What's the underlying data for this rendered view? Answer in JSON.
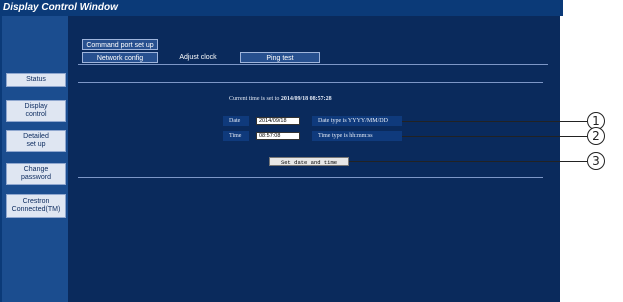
{
  "window": {
    "title": "Display Control Window"
  },
  "sidebar": {
    "items": [
      {
        "label": "Status"
      },
      {
        "label": "Display\ncontrol"
      },
      {
        "label": "Detailed\nset up"
      },
      {
        "label": "Change\npassword"
      },
      {
        "label": "Crestron\nConnected(TM)"
      }
    ]
  },
  "top": {
    "command_port_label": "Command port set up",
    "tabs": [
      {
        "label": "Network config"
      },
      {
        "label": "Adjust clock"
      },
      {
        "label": "Ping test"
      }
    ]
  },
  "clock": {
    "current_time_text": "Current time is set to ",
    "current_time_value": "2014/09/18 08:57:28",
    "date_label": "Date",
    "date_value": "2014/09/18",
    "date_hint": "Date type is YYYY/MM/DD",
    "time_label": "Time",
    "time_value": "08:57:08",
    "time_hint": "Time type is hh:mm:ss",
    "set_button_label": "Set date and time"
  },
  "callouts": [
    "1",
    "2",
    "3"
  ]
}
